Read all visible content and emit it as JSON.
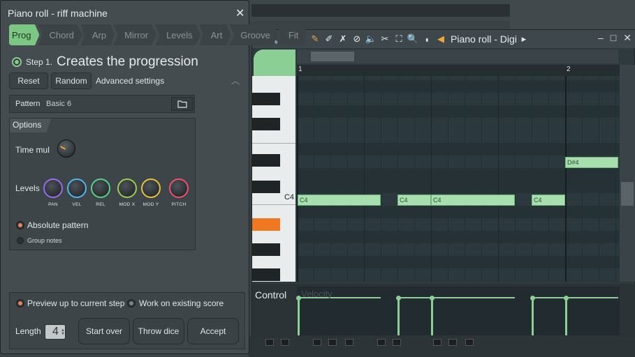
{
  "riff_machine": {
    "title": "Piano roll - riff machine",
    "close_glyph": "✕",
    "tabs": [
      {
        "label": "Prog",
        "active": true
      },
      {
        "label": "Chord",
        "active": false
      },
      {
        "label": "Arp",
        "active": false
      },
      {
        "label": "Mirror",
        "active": false
      },
      {
        "label": "Levels",
        "active": false
      },
      {
        "label": "Art",
        "active": false
      },
      {
        "label": "Groove",
        "active": false
      },
      {
        "label": "Fit",
        "active": false
      }
    ],
    "step_number": "Step 1.",
    "step_description": "Creates the progression",
    "reset_label": "Reset",
    "random_label": "Random",
    "advanced_label": "Advanced settings",
    "pattern_label": "Pattern",
    "pattern_value": "Basic 6",
    "options_title": "Options",
    "time_mul_label": "Time mul",
    "levels_label": "Levels",
    "knobs": [
      {
        "label": "PAN",
        "color": "#9a6cf0"
      },
      {
        "label": "VEL",
        "color": "#4fb6f0"
      },
      {
        "label": "REL",
        "color": "#58d08a"
      },
      {
        "label": "MOD X",
        "color": "#9ccc50"
      },
      {
        "label": "MOD Y",
        "color": "#e8c23a"
      },
      {
        "label": "PITCH",
        "color": "#f0506a"
      }
    ],
    "absolute_pattern_label": "Absolute pattern",
    "group_notes_label": "Group notes",
    "preview_label": "Preview up to current step",
    "work_label": "Work on existing score",
    "length_label": "Length",
    "length_value": "4",
    "start_over_label": "Start over",
    "throw_dice_label": "Throw dice",
    "accept_label": "Accept"
  },
  "piano_roll": {
    "title": "Piano roll - Digi",
    "bar_numbers": [
      "1",
      "2"
    ],
    "key_label": "C4",
    "control_label": "Control",
    "control_ghost": "Velocity",
    "notes": [
      {
        "label": "C4"
      },
      {
        "label": "C4"
      },
      {
        "label": "C4"
      },
      {
        "label": "C4"
      },
      {
        "label": "D#4"
      }
    ]
  }
}
